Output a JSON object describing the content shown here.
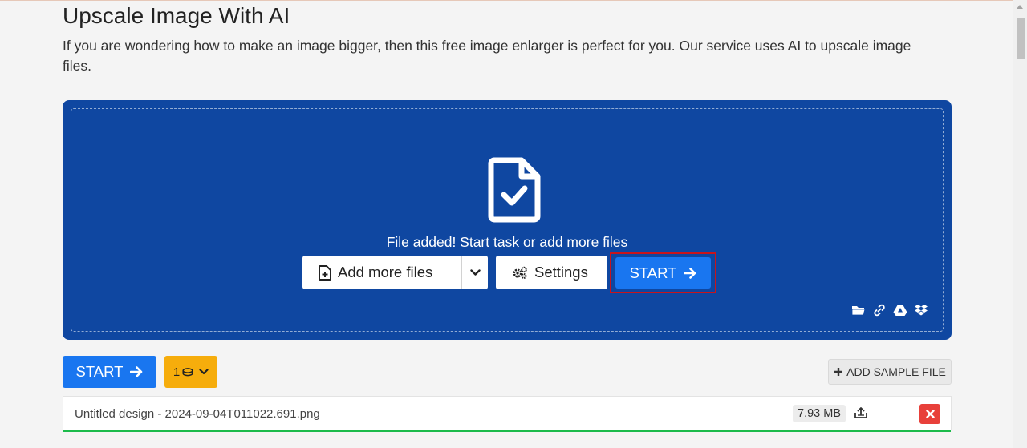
{
  "header": {
    "title": "Upscale Image With AI",
    "description": "If you are wondering how to make an image bigger, then this free image enlarger is perfect for you. Our service uses AI to upscale image files."
  },
  "dropzone": {
    "status_text": "File added! Start task or add more files",
    "add_files_label": "Add more files",
    "settings_label": "Settings",
    "start_label": "START",
    "source_icons": [
      "folder-icon",
      "link-icon",
      "google-drive-icon",
      "dropbox-icon"
    ]
  },
  "toolbar": {
    "start_label": "START",
    "credits_count": "1",
    "add_sample_label": "ADD SAMPLE FILE"
  },
  "files": [
    {
      "name": "Untitled design - 2024-09-04T011022.691.png",
      "size": "7.93 MB",
      "progress": 1.0
    }
  ],
  "colors": {
    "dropzone_bg": "#0f47a1",
    "primary": "#1976f0",
    "credits": "#f6ad0c",
    "danger": "#e8403a",
    "success": "#1cbb4b",
    "highlight": "#c9141b"
  }
}
